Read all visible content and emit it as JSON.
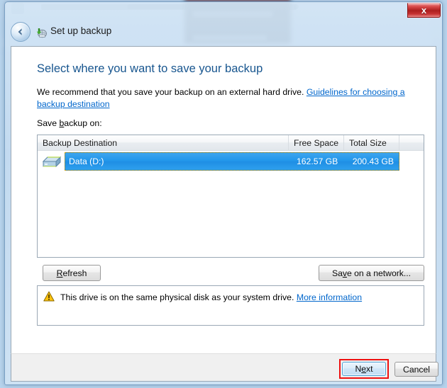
{
  "window": {
    "app_title": "Set up backup",
    "app_icon": "backup-disk-icon",
    "back_icon": "back-arrow-icon",
    "close_label": "x"
  },
  "page": {
    "heading": "Select where you want to save your backup",
    "recommend_prefix": "We recommend that you save your backup on an external hard drive. ",
    "recommend_link": "Guidelines for choosing a backup destination",
    "save_label_pre": "Save ",
    "save_label_accel": "b",
    "save_label_post": "ackup on:"
  },
  "list": {
    "columns": [
      {
        "label": "Backup Destination"
      },
      {
        "label": "Free Space"
      },
      {
        "label": "Total Size"
      },
      {
        "label": ""
      }
    ],
    "rows": [
      {
        "icon": "hard-disk-icon",
        "name": "Data (D:)",
        "free_space": "162.57 GB",
        "total_size": "200.43 GB",
        "selected": true
      }
    ]
  },
  "buttons": {
    "refresh_pre": "",
    "refresh_accel": "R",
    "refresh_post": "efresh",
    "network_pre": "Sa",
    "network_accel": "v",
    "network_post": "e on a network...",
    "next_pre": "N",
    "next_accel": "e",
    "next_post": "xt",
    "cancel_label": "Cancel"
  },
  "warning": {
    "icon": "warning-triangle-icon",
    "text": "This drive is on the same physical disk as your system drive. ",
    "link": "More information"
  },
  "colors": {
    "heading": "#18568f",
    "link": "#0066cc",
    "selection": "#2196ea",
    "highlight_box": "#ee1111",
    "close_button": "#ad1f1f",
    "warning": "#ffc20e"
  }
}
